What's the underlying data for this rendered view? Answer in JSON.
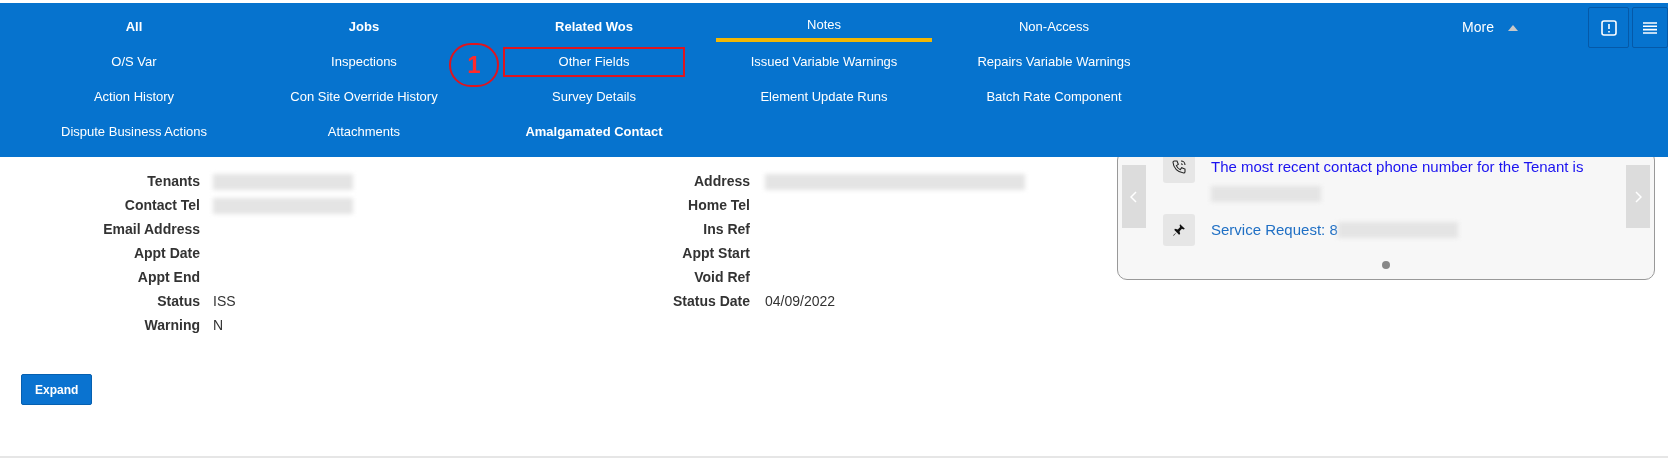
{
  "menu": {
    "items": [
      {
        "label": "All",
        "bold": true,
        "selected": false,
        "highlighted": false
      },
      {
        "label": "Jobs",
        "bold": true,
        "selected": false,
        "highlighted": false
      },
      {
        "label": "Related Wos",
        "bold": true,
        "selected": false,
        "highlighted": false
      },
      {
        "label": "Notes",
        "bold": false,
        "selected": true,
        "highlighted": false
      },
      {
        "label": "Non-Access",
        "bold": false,
        "selected": false,
        "highlighted": false
      },
      {
        "label": "O/S Var",
        "bold": false,
        "selected": false,
        "highlighted": false
      },
      {
        "label": "Inspections",
        "bold": false,
        "selected": false,
        "highlighted": false
      },
      {
        "label": "Other Fields",
        "bold": false,
        "selected": false,
        "highlighted": true
      },
      {
        "label": "Issued Variable Warnings",
        "bold": false,
        "selected": false,
        "highlighted": false
      },
      {
        "label": "Repairs Variable Warnings",
        "bold": false,
        "selected": false,
        "highlighted": false
      },
      {
        "label": "Action History",
        "bold": false,
        "selected": false,
        "highlighted": false
      },
      {
        "label": "Con Site Override History",
        "bold": false,
        "selected": false,
        "highlighted": false
      },
      {
        "label": "Survey Details",
        "bold": false,
        "selected": false,
        "highlighted": false
      },
      {
        "label": "Element Update Runs",
        "bold": false,
        "selected": false,
        "highlighted": false
      },
      {
        "label": "Batch Rate Component",
        "bold": false,
        "selected": false,
        "highlighted": false
      },
      {
        "label": "Dispute Business Actions",
        "bold": false,
        "selected": false,
        "highlighted": false
      },
      {
        "label": "Attachments",
        "bold": false,
        "selected": false,
        "highlighted": false
      },
      {
        "label": "Amalgamated Contact",
        "bold": true,
        "selected": false,
        "highlighted": false
      }
    ],
    "more": {
      "label": "More",
      "expanded": true
    },
    "annotation": "1"
  },
  "fields": [
    {
      "label": "Tenants",
      "redacted": true,
      "label2": "Address",
      "redacted2": true
    },
    {
      "label": "Contact Tel",
      "redacted": true,
      "label2": "Home Tel"
    },
    {
      "label": "Email Address",
      "label2": "Ins Ref"
    },
    {
      "label": "Appt Date",
      "label2": "Appt Start"
    },
    {
      "label": "Appt End",
      "label2": "Void Ref"
    },
    {
      "label": "Status",
      "value": "ISS",
      "label2": "Status Date",
      "value2": "04/09/2022"
    },
    {
      "label": "Warning",
      "value": "N"
    }
  ],
  "expand_button": "Expand",
  "card": {
    "items": [
      {
        "kind": "phone",
        "text": "The most recent contact phone number for the Tenant is"
      },
      {
        "kind": "pin",
        "text": "Service Request: 8"
      }
    ]
  }
}
